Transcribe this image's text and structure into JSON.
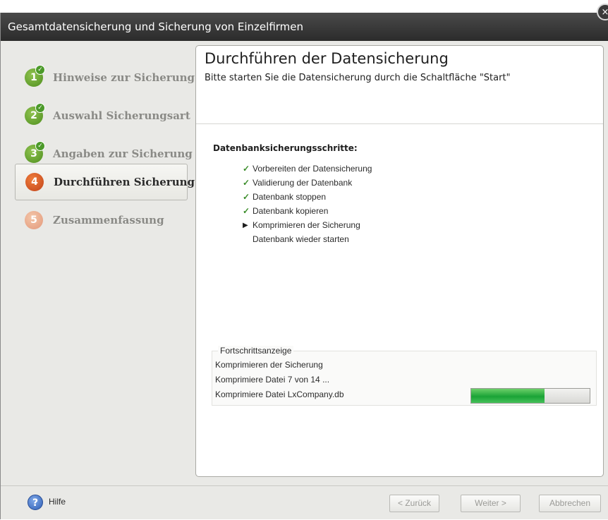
{
  "window": {
    "title": "Gesamtdatensicherung und Sicherung von Einzelfirmen",
    "close_glyph": "×"
  },
  "sidebar": {
    "steps": [
      {
        "number": "1",
        "label": "Hinweise zur Sicherung",
        "state": "done"
      },
      {
        "number": "2",
        "label": "Auswahl Sicherungsart",
        "state": "done"
      },
      {
        "number": "3",
        "label": "Angaben zur Sicherung",
        "state": "done"
      },
      {
        "number": "4",
        "label": "Durchführen Sicherung",
        "state": "active"
      },
      {
        "number": "5",
        "label": "Zusammenfassung",
        "state": "future"
      }
    ],
    "check_glyph": "✓"
  },
  "main": {
    "title": "Durchführen der Datensicherung",
    "subtitle": "Bitte starten Sie die Datensicherung durch die Schaltfläche \"Start\"",
    "steps_heading": "Datenbanksicherungsschritte:",
    "db_steps": [
      {
        "label": "Vorbereiten der Datensicherung",
        "status": "done",
        "icon": "check-icon",
        "glyph": "✓"
      },
      {
        "label": "Validierung der Datenbank",
        "status": "done",
        "icon": "check-icon",
        "glyph": "✓"
      },
      {
        "label": "Datenbank stoppen",
        "status": "done",
        "icon": "check-icon",
        "glyph": "✓"
      },
      {
        "label": "Datenbank kopieren",
        "status": "done",
        "icon": "check-icon",
        "glyph": "✓"
      },
      {
        "label": "Komprimieren der Sicherung",
        "status": "current",
        "icon": "current-arrow-icon",
        "glyph": "▶"
      },
      {
        "label": "Datenbank wieder starten",
        "status": "pending",
        "icon": "",
        "glyph": ""
      }
    ],
    "progress": {
      "legend": "Fortschrittsanzeige",
      "line1": "Komprimieren der Sicherung",
      "line2": "Komprimiere Datei  7 von 14 ...",
      "line3": "Komprimiere Datei LxCompany.db",
      "fraction": 0.62
    }
  },
  "footer": {
    "help_glyph": "?",
    "help_label": "Hilfe",
    "back_label": "< Zurück",
    "next_label": "Weiter >",
    "cancel_label": "Abbrechen"
  },
  "colors": {
    "done": "#4e8e1e",
    "active": "#c1431a",
    "future": "#e3987a",
    "progress": "#1aa336"
  }
}
